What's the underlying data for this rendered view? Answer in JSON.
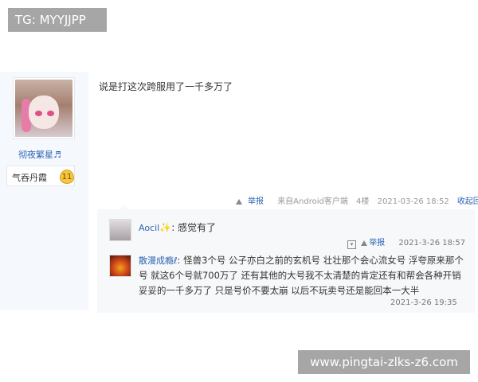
{
  "badge": {
    "text": "TG: MYYJJPP"
  },
  "user": {
    "name": "彻夜繁星♬",
    "rank_title": "气吞丹霞",
    "level": "11"
  },
  "post": {
    "content": "说是打这次跨服用了一千多万了",
    "report_label": "举报",
    "source": "来自Android客户端",
    "floor": "4楼",
    "timestamp": "2021-03-26 18:52",
    "collapse_label": "收起回复"
  },
  "replies": [
    {
      "author": "Aocil",
      "badge": "✨",
      "text": "感觉有了",
      "report_label": "举报",
      "timestamp": "2021-3-26 18:57"
    },
    {
      "author": "散漫成瘾",
      "badge": "ℓ",
      "text": "怪兽3个号 公子亦白之前的玄机号 壮壮那个会心流女号 浮夸原来那个号 就这6个号就700万了 还有其他的大号我不太清楚的肯定还有和帮会各种开销 妥妥的一千多万了 只是号价不要太崩 以后不玩卖号还是能回本一大半",
      "timestamp": "2021-3-26 19:35"
    }
  ],
  "watermark": {
    "text": "www.pingtai-zlks-z6.com"
  },
  "icons": {
    "report": "report-triangle-icon",
    "dropdown": "dropdown-icon"
  }
}
